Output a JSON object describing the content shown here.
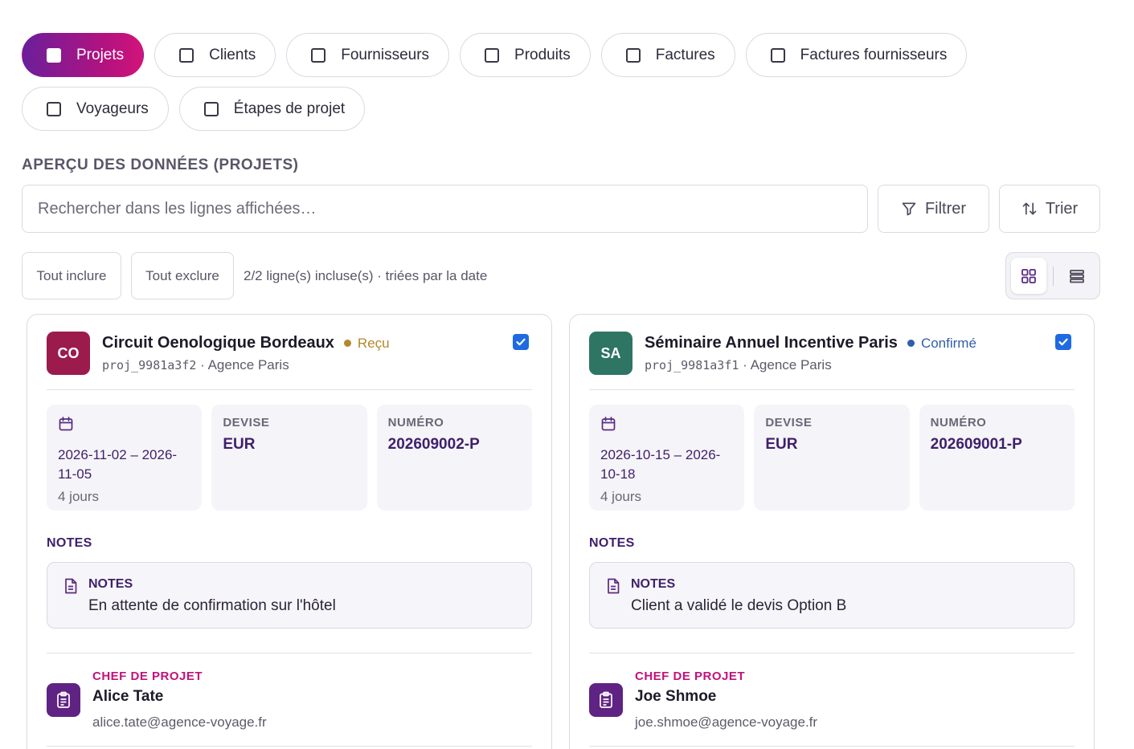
{
  "entity_tabs": [
    {
      "label": "Projets",
      "active": true
    },
    {
      "label": "Clients",
      "active": false
    },
    {
      "label": "Fournisseurs",
      "active": false
    },
    {
      "label": "Produits",
      "active": false
    },
    {
      "label": "Factures",
      "active": false
    },
    {
      "label": "Factures fournisseurs",
      "active": false
    },
    {
      "label": "Voyageurs",
      "active": false
    },
    {
      "label": "Étapes de projet",
      "active": false
    }
  ],
  "section_title": "APERÇU DES DONNÉES (PROJETS)",
  "search": {
    "placeholder": "Rechercher dans les lignes affichées…"
  },
  "toolbar": {
    "filter_label": "Filtrer",
    "sort_label": "Trier"
  },
  "selection": {
    "include_all": "Tout inclure",
    "exclude_all": "Tout exclure",
    "summary": "2/2 ligne(s) incluse(s) · triées par la date"
  },
  "view_mode": "grid",
  "cards": [
    {
      "initials": "CO",
      "avatar_color": "#9b1b4d",
      "title": "Circuit Oenologique Bordeaux",
      "status": "Reçu",
      "status_color": "#b4872a",
      "id": "proj_9981a3f2",
      "agency": "· Agence Paris",
      "checked": true,
      "dates": "2026-11-02 – 2026-11-05",
      "dates_line1": "2026-11-02 – 2026-",
      "dates_line2": "11-05",
      "duration": "4 jours",
      "currency_label": "DEVISE",
      "currency": "EUR",
      "number_label": "NUMÉRO",
      "number": "202609002-P",
      "notes_section": "NOTES",
      "notes_title": "NOTES",
      "notes_text": "En attente de confirmation sur l'hôtel",
      "manager_label": "CHEF DE PROJET",
      "manager_name": "Alice Tate",
      "manager_email": "alice.tate@agence-voyage.fr"
    },
    {
      "initials": "SA",
      "avatar_color": "#2e7564",
      "title": "Séminaire Annuel Incentive Paris",
      "status": "Confirmé",
      "status_color": "#2f5faa",
      "id": "proj_9981a3f1",
      "agency": "· Agence Paris",
      "checked": true,
      "dates": "2026-10-15 – 2026-10-18",
      "dates_line1": "2026-10-15 – 2026-",
      "dates_line2": "10-18",
      "duration": "4 jours",
      "currency_label": "DEVISE",
      "currency": "EUR",
      "number_label": "NUMÉRO",
      "number": "202609001-P",
      "notes_section": "NOTES",
      "notes_title": "NOTES",
      "notes_text": "Client a validé le devis Option B",
      "manager_label": "CHEF DE PROJET",
      "manager_name": "Joe Shmoe",
      "manager_email": "joe.shmoe@agence-voyage.fr"
    }
  ]
}
